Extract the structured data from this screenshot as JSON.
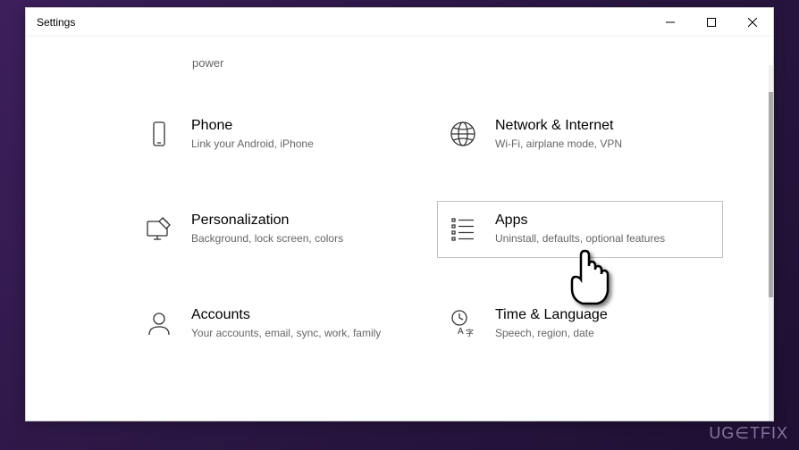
{
  "window": {
    "title": "Settings"
  },
  "fragment": "power",
  "categories": [
    {
      "id": "phone",
      "title": "Phone",
      "desc": "Link your Android, iPhone",
      "icon": "phone-icon"
    },
    {
      "id": "network",
      "title": "Network & Internet",
      "desc": "Wi-Fi, airplane mode, VPN",
      "icon": "globe-icon"
    },
    {
      "id": "personalization",
      "title": "Personalization",
      "desc": "Background, lock screen, colors",
      "icon": "personalization-icon"
    },
    {
      "id": "apps",
      "title": "Apps",
      "desc": "Uninstall, defaults, optional features",
      "icon": "apps-icon",
      "selected": true
    },
    {
      "id": "accounts",
      "title": "Accounts",
      "desc": "Your accounts, email, sync, work, family",
      "icon": "accounts-icon"
    },
    {
      "id": "time",
      "title": "Time & Language",
      "desc": "Speech, region, date",
      "icon": "time-language-icon"
    }
  ],
  "watermark": "UG∈TFIX"
}
